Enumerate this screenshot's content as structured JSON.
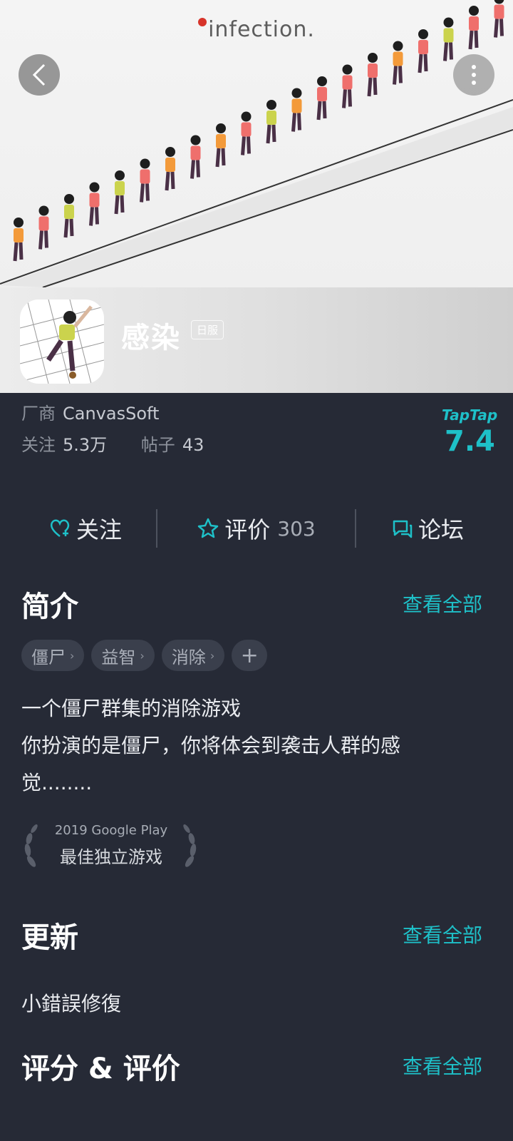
{
  "banner": {
    "logo_text": "infection.",
    "back_icon": "chevron-left-icon",
    "more_icon": "more-icon"
  },
  "app": {
    "title": "感染",
    "region_badge": "日服",
    "vendor_label": "厂商",
    "vendor_value": "CanvasSoft",
    "follow_label": "关注",
    "follow_value": "5.3万",
    "posts_label": "帖子",
    "posts_value": "43",
    "rating_brand": "TapTap",
    "rating_score": "7.4"
  },
  "actions": {
    "follow": "关注",
    "review": "评价",
    "review_count": "303",
    "forum": "论坛"
  },
  "intro": {
    "title": "简介",
    "see_all": "查看全部",
    "tags": [
      "僵尸",
      "益智",
      "消除"
    ],
    "add_tag": "+",
    "line1": "一个僵尸群集的消除游戏",
    "line2": "你扮演的是僵尸，你将体会到袭击人群的感",
    "line3": "觉........"
  },
  "award": {
    "line1": "2019 Google Play",
    "line2": "最佳独立游戏"
  },
  "update": {
    "title": "更新",
    "see_all": "查看全部",
    "text": "小錯誤修復"
  },
  "ratings": {
    "title": "评分 & 评价",
    "see_all": "查看全部"
  },
  "colors": {
    "accent": "#1ec0c8",
    "background": "#262a36"
  }
}
